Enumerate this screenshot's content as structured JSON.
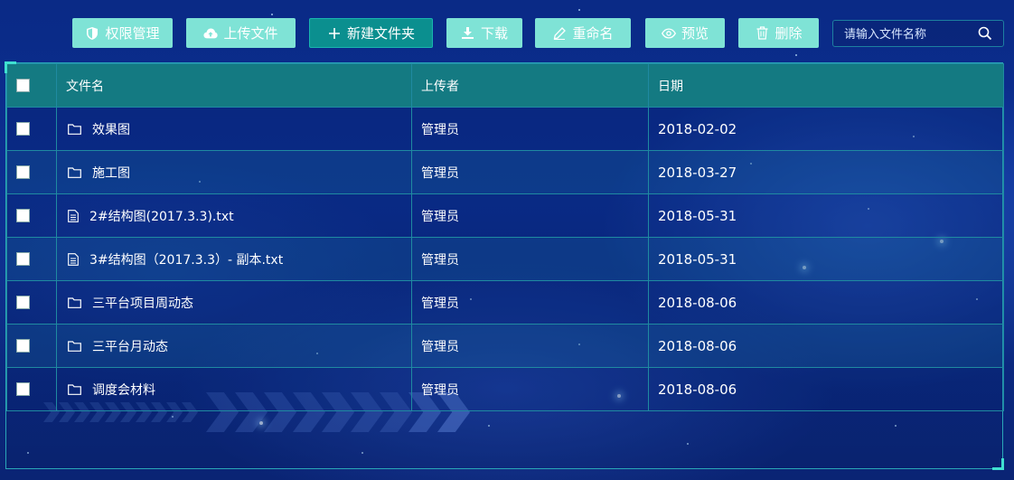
{
  "toolbar": {
    "permissions": {
      "label": "权限管理",
      "icon": "shield-icon"
    },
    "upload": {
      "label": "上传文件",
      "icon": "cloud-upload-icon"
    },
    "new_folder": {
      "label": "新建文件夹",
      "icon": "plus-icon"
    },
    "download": {
      "label": "下载",
      "icon": "download-icon"
    },
    "rename": {
      "label": "重命名",
      "icon": "pencil-icon"
    },
    "preview": {
      "label": "预览",
      "icon": "eye-icon"
    },
    "delete": {
      "label": "删除",
      "icon": "trash-icon"
    }
  },
  "search": {
    "placeholder": "请输入文件名称",
    "value": "",
    "icon": "search-icon"
  },
  "table": {
    "columns": [
      "文件名",
      "上传者",
      "日期"
    ],
    "rows": [
      {
        "type": "folder",
        "name": "效果图",
        "uploader": "管理员",
        "date": "2018-02-02"
      },
      {
        "type": "folder",
        "name": "施工图",
        "uploader": "管理员",
        "date": "2018-03-27"
      },
      {
        "type": "file",
        "name": "2#结构图(2017.3.3).txt",
        "uploader": "管理员",
        "date": "2018-05-31"
      },
      {
        "type": "file",
        "name": "3#结构图（2017.3.3）- 副本.txt",
        "uploader": "管理员",
        "date": "2018-05-31"
      },
      {
        "type": "folder",
        "name": "三平台项目周动态",
        "uploader": "管理员",
        "date": "2018-08-06"
      },
      {
        "type": "folder",
        "name": "三平台月动态",
        "uploader": "管理员",
        "date": "2018-08-06"
      },
      {
        "type": "folder",
        "name": "调度会材料",
        "uploader": "管理员",
        "date": "2018-08-06"
      }
    ]
  },
  "colors": {
    "button_bg": "#7fe3d6",
    "button_active_bg": "#0b8f8f",
    "header_bg": "#147a82",
    "border": "#1f8aa1",
    "corner_accent": "#3fe0d0",
    "background": "#0c2f92"
  }
}
